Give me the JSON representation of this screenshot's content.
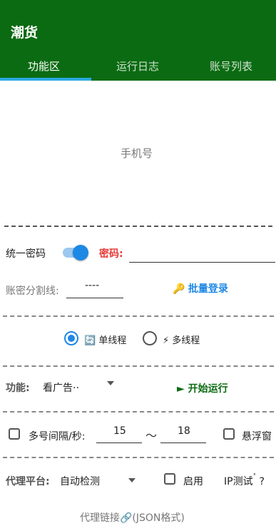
{
  "app": {
    "title": "潮货"
  },
  "tabs": [
    {
      "label": "功能区",
      "active": true
    },
    {
      "label": "运行日志",
      "active": false
    },
    {
      "label": "账号列表",
      "active": false
    }
  ],
  "phone_input": {
    "placeholder": "手机号"
  },
  "password": {
    "unify_label": "统一密码",
    "unify_enabled": true,
    "label": "密码:",
    "value": ""
  },
  "split": {
    "label": "账密分割线:",
    "value": "----",
    "batch_login": "批量登录",
    "batch_icon": "🔑"
  },
  "threads": {
    "single_label": "单线程",
    "single_icon": "🔄",
    "multi_label": "多线程",
    "multi_icon": "⚡",
    "selected": "single"
  },
  "function": {
    "label": "功能:",
    "selected": "看广告··",
    "start_label": "► 开始运行"
  },
  "interval": {
    "label": "多号间隔/秒:",
    "min": "15",
    "tilde": "～",
    "max": "18",
    "float_window_label": "悬浮窗"
  },
  "proxy": {
    "label": "代理平台:",
    "selected": "自动检测",
    "enable_label": "启用",
    "ip_test_label": "IP测试",
    "ip_test_suffix": "?",
    "link_label": "代理链接🔗(JSON格式)"
  },
  "colors": {
    "primary": "#0b6b12",
    "accent": "#1e88e5",
    "tab_indicator": "#2aa9e0",
    "password_red": "#e53935"
  }
}
